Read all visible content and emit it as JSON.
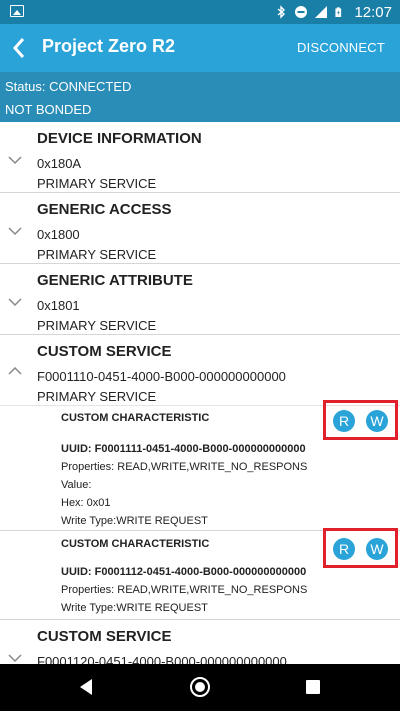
{
  "status_bar": {
    "time": "12:07"
  },
  "app_bar": {
    "title": "Project Zero R2",
    "action": "DISCONNECT"
  },
  "connection": {
    "status": "Status: CONNECTED",
    "bond": "NOT BONDED"
  },
  "services": [
    {
      "name": "DEVICE INFORMATION",
      "uuid": "0x180A",
      "type": "PRIMARY SERVICE",
      "expanded": false
    },
    {
      "name": "GENERIC ACCESS",
      "uuid": "0x1800",
      "type": "PRIMARY SERVICE",
      "expanded": false
    },
    {
      "name": "GENERIC ATTRIBUTE",
      "uuid": "0x1801",
      "type": "PRIMARY SERVICE",
      "expanded": false
    },
    {
      "name": "CUSTOM SERVICE",
      "uuid": "F0001110-0451-4000-B000-000000000000",
      "type": "PRIMARY SERVICE",
      "expanded": true
    },
    {
      "name": "CUSTOM SERVICE",
      "uuid": "F0001120-0451-4000-B000-000000000000",
      "type": "PRIMARY SERVICE",
      "expanded": false
    }
  ],
  "characteristics": [
    {
      "name": "CUSTOM CHARACTERISTIC",
      "uuid": "UUID: F0001111-0451-4000-B000-000000000000",
      "properties": "Properties: READ,WRITE,WRITE_NO_RESPONS",
      "value": "Value:",
      "hex": "Hex: 0x01",
      "write_type": "Write Type:WRITE REQUEST",
      "read_label": "R",
      "write_label": "W"
    },
    {
      "name": "CUSTOM CHARACTERISTIC",
      "uuid": "UUID: F0001112-0451-4000-B000-000000000000",
      "properties": "Properties: READ,WRITE,WRITE_NO_RESPONS",
      "write_type": "Write Type:WRITE REQUEST",
      "read_label": "R",
      "write_label": "W"
    }
  ],
  "colors": {
    "status_bar": "#1a7fa6",
    "app_bar": "#2aa3d8",
    "status_band": "#2a8db7",
    "highlight": "#e0202a"
  },
  "icons": [
    "image-icon",
    "bluetooth-icon",
    "do-not-disturb-icon",
    "signal-icon",
    "battery-icon",
    "back-arrow-icon",
    "chevron-down-icon",
    "chevron-up-icon"
  ]
}
